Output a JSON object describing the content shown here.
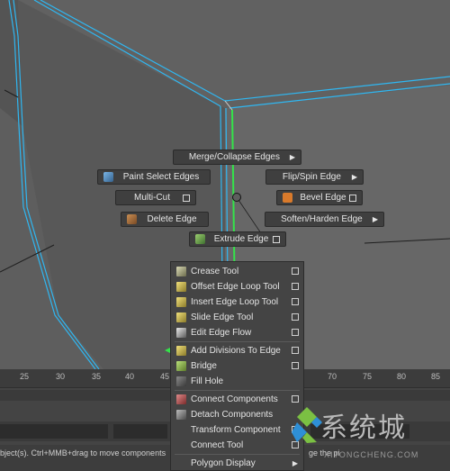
{
  "colors": {
    "accent_cyan": "#2fb7f2",
    "edge_green": "#34e34a",
    "menu_bg": "#444444",
    "viewport_bg": "#5e5e5e"
  },
  "marking_menu": {
    "north": {
      "label": "Merge/Collapse Edges",
      "has_submenu": true
    },
    "north_west": {
      "label": "Paint Select Edges",
      "icon": "paint-brush-icon"
    },
    "north_east": {
      "label": "Flip/Spin Edge",
      "has_submenu": true
    },
    "west": {
      "label": "Multi-Cut",
      "has_options": true
    },
    "east": {
      "label": "Bevel Edge",
      "icon": "bevel-icon",
      "has_options": true
    },
    "south_west": {
      "label": "Delete Edge",
      "icon": "delete-edge-icon"
    },
    "south_east": {
      "label": "Soften/Harden Edge",
      "has_submenu": true
    },
    "south": {
      "label": "Extrude Edge",
      "icon": "extrude-icon",
      "has_options": true
    }
  },
  "dropdown": {
    "items": [
      {
        "label": "Crease Tool",
        "icon": "crease-icon",
        "options": true
      },
      {
        "label": "Offset Edge Loop Tool",
        "icon": "offset-edge-loop-icon",
        "options": true
      },
      {
        "label": "Insert Edge Loop Tool",
        "icon": "insert-edge-loop-icon",
        "options": true
      },
      {
        "label": "Slide Edge Tool",
        "icon": "slide-edge-icon",
        "options": true
      },
      {
        "label": "Edit Edge Flow",
        "icon": "edit-edge-flow-icon",
        "options": true
      },
      {
        "label": "Add Divisions To Edge",
        "icon": "add-divisions-icon",
        "options": true
      },
      {
        "label": "Bridge",
        "icon": "bridge-icon",
        "options": true
      },
      {
        "label": "Fill Hole",
        "icon": "fill-hole-icon",
        "options": false
      },
      {
        "label": "Connect Components",
        "icon": "connect-components-icon",
        "options": true
      },
      {
        "label": "Detach Components",
        "icon": "detach-components-icon",
        "options": false
      },
      {
        "label": "Transform Component",
        "icon": "",
        "options": true
      },
      {
        "label": "Connect Tool",
        "icon": "",
        "options": true
      },
      {
        "label": "Polygon Display",
        "icon": "",
        "submenu": true
      }
    ]
  },
  "timeline": {
    "ticks": [
      "25",
      "30",
      "35",
      "40",
      "45",
      "70",
      "75",
      "80",
      "85"
    ]
  },
  "help_line": {
    "left": "bject(s). Ctrl+MMB+drag to move components",
    "right": "ge the pi"
  },
  "watermark": {
    "big": "系统城",
    "small": "XITONGCHENG.COM"
  }
}
